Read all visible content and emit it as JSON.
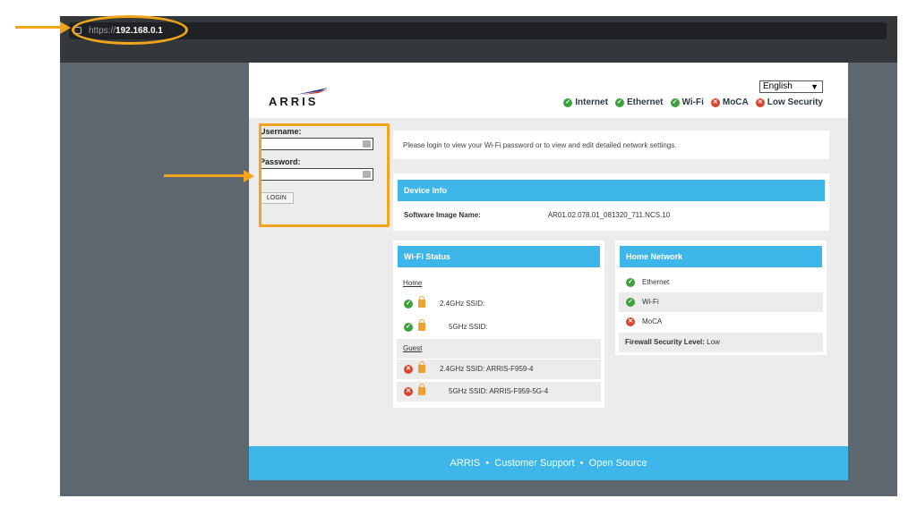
{
  "browser": {
    "address_protocol": "https://",
    "address_host": "192.168.0.1"
  },
  "header": {
    "logo_text": "ARRIS",
    "language": "English",
    "status": [
      {
        "label": "Internet",
        "state": "ok"
      },
      {
        "label": "Ethernet",
        "state": "ok"
      },
      {
        "label": "Wi-Fi",
        "state": "ok"
      },
      {
        "label": "MoCA",
        "state": "bad"
      },
      {
        "label": "Low Security",
        "state": "bad"
      }
    ]
  },
  "login": {
    "username_label": "Username:",
    "password_label": "Password:",
    "button_label": "LOGIN"
  },
  "message": "Please login to view your Wi-Fi password or to view and edit detailed network settings.",
  "device_info": {
    "title": "Device Info",
    "software_label": "Software Image Name:",
    "software_value": "AR01.02.078.01_081320_711.NCS.10"
  },
  "wifi_status": {
    "title": "Wi-Fi Status",
    "home_label": "Home",
    "home_24": "2.4GHz SSID:",
    "home_5": "5GHz SSID:",
    "guest_label": "Guest",
    "guest_24": "2.4GHz SSID: ARRIS-F959-4",
    "guest_5": "5GHz SSID: ARRIS-F959-5G-4"
  },
  "home_network": {
    "title": "Home Network",
    "ethernet": "Ethernet",
    "wifi": "Wi-Fi",
    "moca": "MoCA",
    "firewall_label": "Firewall Security Level:",
    "firewall_value": "Low"
  },
  "footer": {
    "brand": "ARRIS",
    "sep1": "•",
    "support": "Customer Support",
    "sep2": "•",
    "open_source": "Open Source"
  },
  "colors": {
    "accent_blue": "#3eb6ea",
    "ok_green": "#3da23d",
    "error_red": "#d9452f",
    "annotation_orange": "#f2a51a"
  }
}
